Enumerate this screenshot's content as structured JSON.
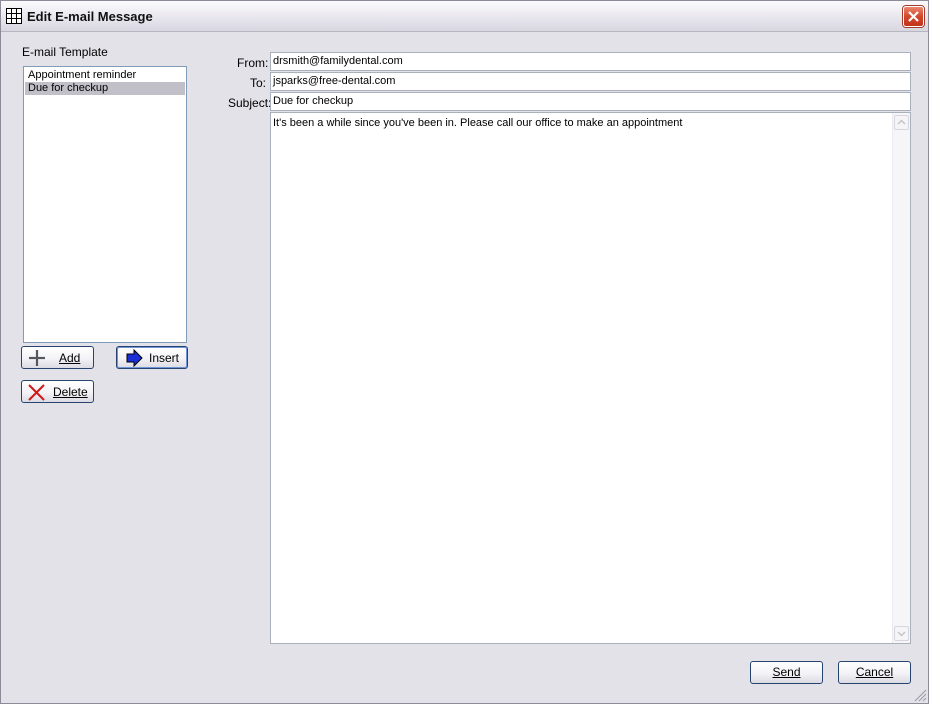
{
  "window": {
    "title": "Edit E-mail Message"
  },
  "templates": {
    "label": "E-mail Template",
    "items": [
      "Appointment reminder",
      "Due for checkup"
    ],
    "selected_index": 1
  },
  "buttons": {
    "add": "Add",
    "insert": "Insert",
    "delete": "Delete",
    "send": "Send",
    "cancel": "Cancel"
  },
  "form": {
    "from_label": "From:",
    "from_value": "drsmith@familydental.com",
    "to_label": "To:",
    "to_value": "jsparks@free-dental.com",
    "subject_label": "Subject:",
    "subject_value": "Due for checkup",
    "body": "It's been a while since you've been in.  Please call our office to make an appointment"
  },
  "icons": {
    "app": "grid-icon",
    "close": "close-icon",
    "add": "plus-icon",
    "insert": "arrow-right-icon",
    "delete": "x-icon"
  },
  "colors": {
    "close": "#d2472b",
    "selection": "#c1c0c8",
    "insert_arrow": "#1a2fd6",
    "delete_x": "#d01818"
  }
}
